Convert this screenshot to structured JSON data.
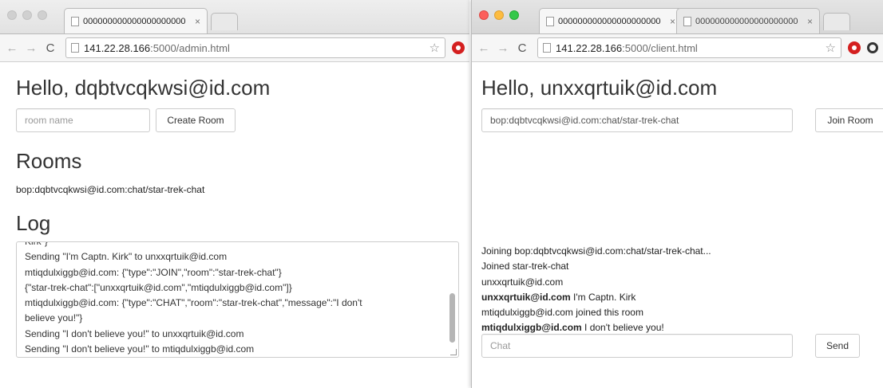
{
  "left": {
    "tab_title": "000000000000000000000",
    "tab_close": "×",
    "url_host": "141.22.28.166",
    "url_path": ":5000/admin.html",
    "nav_back": "←",
    "nav_forward": "→",
    "nav_reload": "C",
    "star": "☆",
    "greeting": "Hello, dqbtvcqkwsi@id.com",
    "room_input_placeholder": "room name",
    "create_room_label": "Create Room",
    "rooms_heading": "Rooms",
    "rooms": [
      "bop:dqbtvcqkwsi@id.com:chat/star-trek-chat"
    ],
    "log_heading": "Log",
    "log_lines": [
      "Kirk\"}",
      "Sending \"I'm Captn. Kirk\" to unxxqrtuik@id.com",
      "mtiqdulxiggb@id.com: {\"type\":\"JOIN\",\"room\":\"star-trek-chat\"}",
      "{\"star-trek-chat\":[\"unxxqrtuik@id.com\",\"mtiqdulxiggb@id.com\"]}",
      "mtiqdulxiggb@id.com: {\"type\":\"CHAT\",\"room\":\"star-trek-chat\",\"message\":\"I don't",
      "believe you!\"}",
      "Sending \"I don't believe you!\" to unxxqrtuik@id.com",
      "Sending \"I don't believe you!\" to mtiqdulxiggb@id.com"
    ]
  },
  "right": {
    "tab1_title": "000000000000000000000",
    "tab2_title": "000000000000000000000",
    "tab_close": "×",
    "url_host": "141.22.28.166",
    "url_path": ":5000/client.html",
    "nav_back": "←",
    "nav_forward": "→",
    "nav_reload": "C",
    "star": "☆",
    "greeting": "Hello, unxxqrtuik@id.com",
    "join_input_value": "bop:dqbtvcqkwsi@id.com:chat/star-trek-chat",
    "join_room_label": "Join Room",
    "chat_lines": [
      {
        "sender": "",
        "text": "Joining bop:dqbtvcqkwsi@id.com:chat/star-trek-chat..."
      },
      {
        "sender": "",
        "text": "Joined star-trek-chat"
      },
      {
        "sender": "",
        "text": "unxxqrtuik@id.com"
      },
      {
        "sender": "unxxqrtuik@id.com",
        "text": " I'm Captn. Kirk"
      },
      {
        "sender": "",
        "text": "mtiqdulxiggb@id.com joined this room"
      },
      {
        "sender": "mtiqdulxiggb@id.com",
        "text": " I don't believe you!"
      }
    ],
    "chat_input_placeholder": "Chat",
    "send_label": "Send"
  }
}
